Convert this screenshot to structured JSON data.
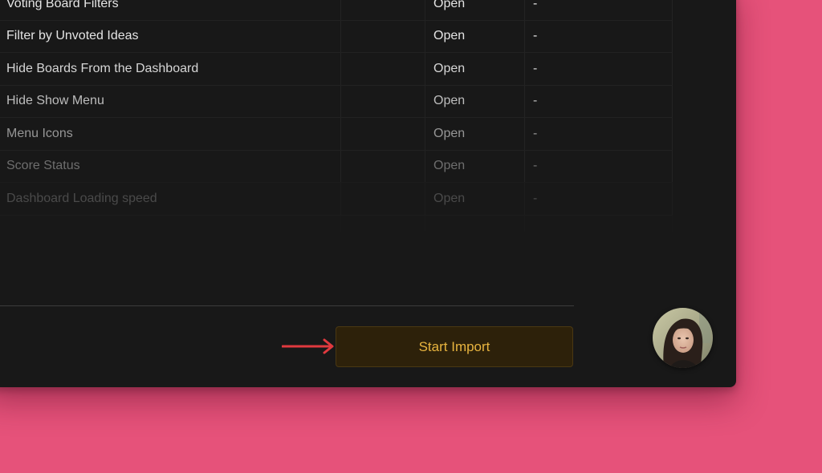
{
  "table": {
    "rows": [
      {
        "name": "Voting Board Filters",
        "status": "Open",
        "extra": "-"
      },
      {
        "name": "Filter by Unvoted Ideas",
        "status": "Open",
        "extra": "-"
      },
      {
        "name": "Hide Boards From the Dashboard",
        "status": "Open",
        "extra": "-"
      },
      {
        "name": "Hide Show Menu",
        "status": "Open",
        "extra": "-"
      },
      {
        "name": "Menu Icons",
        "status": "Open",
        "extra": "-"
      },
      {
        "name": "Score Status",
        "status": "Open",
        "extra": "-"
      },
      {
        "name": "Dashboard Loading speed",
        "status": "Open",
        "extra": "-"
      }
    ]
  },
  "footer": {
    "start_import_label": "Start Import"
  },
  "colors": {
    "background": "#e6527a",
    "panel": "#181818",
    "button_bg": "#2d210a",
    "button_text": "#e8b43f",
    "arrow": "#e0393e"
  },
  "icons": {
    "pointer": "arrow-right-icon",
    "avatar": "user-avatar"
  }
}
